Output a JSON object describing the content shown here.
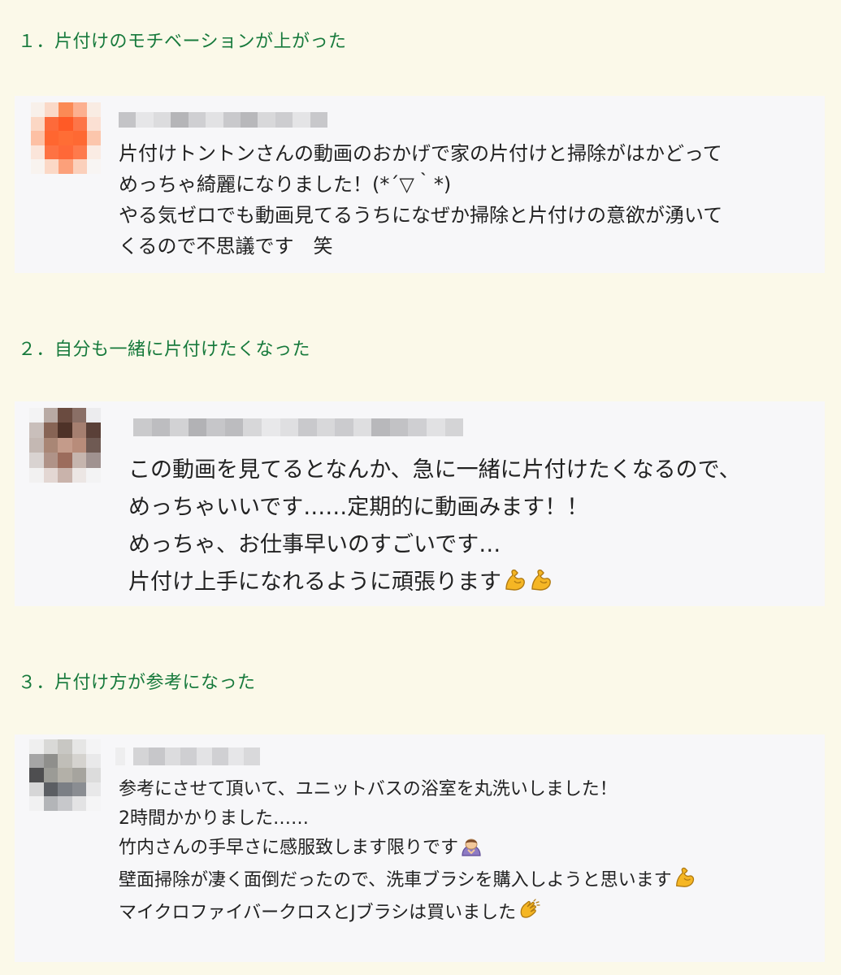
{
  "sections": [
    {
      "heading": "１．片付けのモチベーションが上がった",
      "comment_lines": [
        "片付けトントンさんの動画のおかげで家の片付けと掃除がはかどって",
        "めっちゃ綺麗になりました！(*´▽｀*)",
        "やる気ゼロでも動画見てるうちになぜか掃除と片付けの意欲が湧いて",
        "くるので不思議です　笑"
      ]
    },
    {
      "heading": "２．自分も一緒に片付けたくなった",
      "comment_lines": [
        "この動画を見てるとなんか、急に一緒に片付けたくなるので、",
        "めっちゃいいです……定期的に動画みます！！",
        "めっちゃ、お仕事早いのすごいです…",
        "片付け上手になれるように頑張ります"
      ],
      "emojis": [
        "flexed-biceps",
        "flexed-biceps"
      ]
    },
    {
      "heading": "３．片付け方が参考になった",
      "comment_lines": [
        "参考にさせて頂いて、ユニットバスの浴室を丸洗いしました！",
        "2時間かかりました……",
        "竹内さんの手早さに感服致します限りです",
        "",
        "壁面掃除が凄く面倒だったので、洗車ブラシを購入しようと思います",
        "マイクロファイバークロスとJブラシは買いました"
      ],
      "emojis": [
        "person-bowing",
        "flexed-biceps",
        "clapping-hands"
      ]
    }
  ],
  "colors": {
    "page_background": "#fbf9e9",
    "heading_text": "#177a3c",
    "card_background": "#f7f7f9",
    "comment_text": "#222222"
  }
}
